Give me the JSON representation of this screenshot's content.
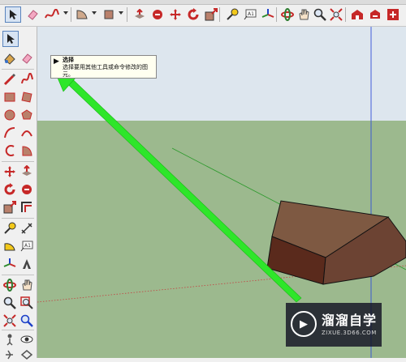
{
  "toolbar": {
    "tools": [
      "select-icon",
      "eraser-icon",
      "freehand-icon",
      "arc-icon",
      "shape-icon",
      "push-pull-icon",
      "follow-me-icon",
      "move-icon",
      "rotate-icon",
      "scale-icon",
      "tape-icon",
      "text-icon",
      "axes-icon",
      "orbit-icon",
      "pan-icon",
      "zoom-icon",
      "zoom-extents-icon",
      "warehouse-icon",
      "share-icon",
      "extension-icon"
    ]
  },
  "sidebar": {
    "tools": [
      "select-icon",
      "eraser-icon",
      "paint-icon",
      "pencil-icon",
      "freehand-icon",
      "rectangle-icon",
      "rotated-rect-icon",
      "circle-icon",
      "polygon-icon",
      "arc-icon",
      "arc-2pt-icon",
      "arc-3pt-icon",
      "pie-icon",
      "move-icon",
      "push-pull-icon",
      "rotate-icon",
      "follow-me-icon",
      "scale-icon",
      "offset-icon",
      "tape-icon",
      "dimension-icon",
      "protractor-icon",
      "text-icon",
      "axes-icon",
      "3dtext-icon",
      "orbit-icon",
      "pan-icon",
      "zoom-icon",
      "zoom-window-icon",
      "zoom-extents-icon",
      "previous-view-icon",
      "position-camera-icon",
      "look-around-icon",
      "walk-icon",
      "section-icon"
    ]
  },
  "tooltip": {
    "title": "选择",
    "description": "选择要用其他工具或命令修改的图元。"
  },
  "watermark": {
    "title": "溜溜自学",
    "subtitle": "ZIXUE.3D66.COM"
  },
  "colors": {
    "sky": "#dde6ee",
    "ground": "#9cb98e",
    "box_top": "#7e5942",
    "box_front": "#6c4333",
    "box_side": "#5a2a1c",
    "arrow": "#2ee62a"
  }
}
